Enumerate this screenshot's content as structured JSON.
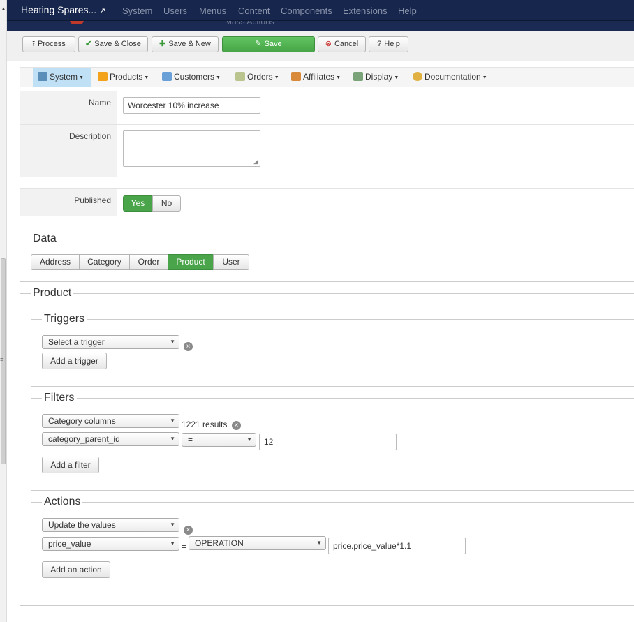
{
  "topnav": {
    "brand": "Heating Spares...",
    "brand_icon": "external-link-icon",
    "menu": [
      "System",
      "Users",
      "Menus",
      "Content",
      "Components",
      "Extensions",
      "Help"
    ],
    "subheader_faint": "Mass Actions"
  },
  "toolbar": {
    "process": "Process",
    "save_close": "Save & Close",
    "save_new": "Save & New",
    "save": "Save",
    "cancel": "Cancel",
    "help": "Help"
  },
  "component_menu": [
    "System",
    "Products",
    "Customers",
    "Orders",
    "Affiliates",
    "Display",
    "Documentation"
  ],
  "form": {
    "name_label": "Name",
    "name_value": "Worcester 10% increase",
    "description_label": "Description",
    "description_value": "",
    "published_label": "Published",
    "published_yes": "Yes",
    "published_no": "No",
    "published_selected": "Yes"
  },
  "data_section": {
    "legend": "Data",
    "tabs": [
      "Address",
      "Category",
      "Order",
      "Product",
      "User"
    ],
    "selected": "Product"
  },
  "product_section": {
    "legend": "Product",
    "triggers": {
      "legend": "Triggers",
      "select": "Select a trigger",
      "add_button": "Add a trigger"
    },
    "filters": {
      "legend": "Filters",
      "type_select": "Category columns",
      "results": "1221 results",
      "column_select": "category_parent_id",
      "operator_select": "=",
      "value": "12",
      "add_button": "Add a filter"
    },
    "actions": {
      "legend": "Actions",
      "type_select": "Update the values",
      "column_select": "price_value",
      "equals": "=",
      "mode_select": "OPERATION",
      "value": "price.price_value*1.1",
      "add_button": "Add an action"
    }
  },
  "colors": {
    "topnav_bg": "#17264d",
    "success_green": "#4aa54a",
    "menu_active": "#bfe0f5"
  }
}
